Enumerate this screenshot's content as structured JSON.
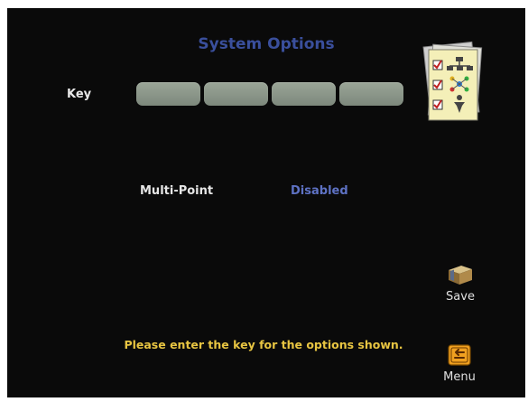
{
  "screen": {
    "title": "System Options"
  },
  "key": {
    "label": "Key",
    "segments": [
      "",
      "",
      "",
      ""
    ]
  },
  "options": [
    {
      "label": "Multi-Point",
      "value": "Disabled"
    }
  ],
  "buttons": {
    "save_label": "Save",
    "menu_label": "Menu"
  },
  "message": "Please enter the key for the options shown.",
  "colors": {
    "background": "#0a0a0a",
    "title": "#3a4f9c",
    "value": "#5e72c4",
    "message": "#e8c542",
    "key_field": "#8a9588"
  },
  "icons": {
    "options": "checklist-options-icon",
    "save": "save-box-icon",
    "menu": "menu-back-icon"
  }
}
